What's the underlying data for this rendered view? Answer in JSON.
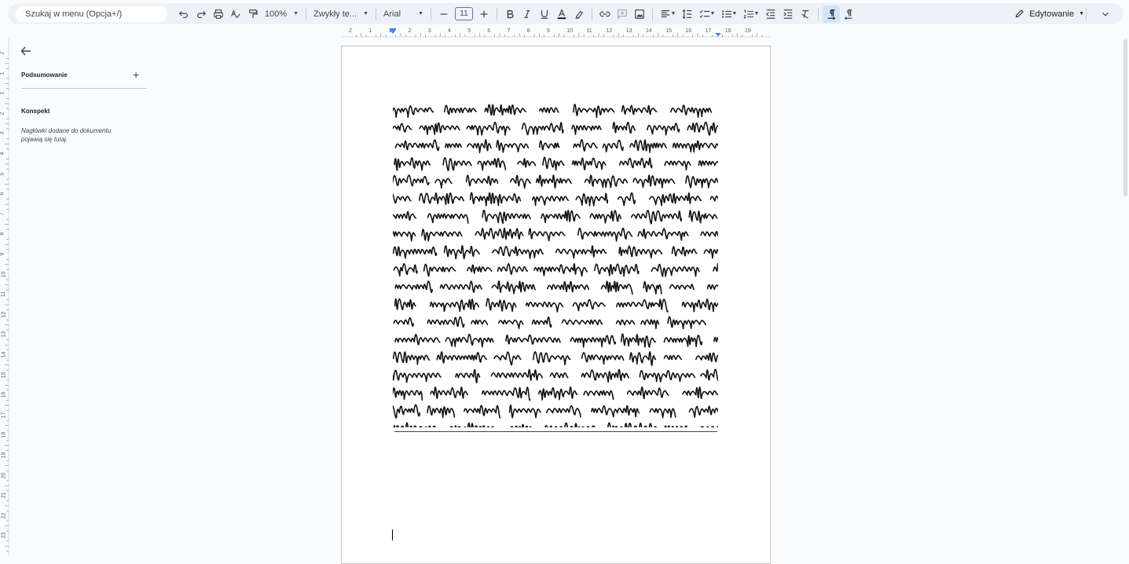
{
  "toolbar": {
    "search_placeholder": "Szukaj w menu (Opcja+/)",
    "zoom": "100%",
    "style": "Zwykły te...",
    "font": "Arial",
    "font_size": "11",
    "mode": "Edytowanie"
  },
  "ruler": {
    "horizontal": [
      "2",
      "1",
      "1",
      "2",
      "3",
      "4",
      "5",
      "6",
      "7",
      "8",
      "9",
      "10",
      "11",
      "12",
      "13",
      "14",
      "15",
      "16",
      "17",
      "18",
      "19"
    ],
    "vertical": [
      "2",
      "1",
      "1",
      "2",
      "3",
      "4",
      "5",
      "6",
      "7",
      "8",
      "9",
      "10",
      "11",
      "12",
      "13",
      "14",
      "15",
      "16",
      "17",
      "18",
      "19",
      "20",
      "21",
      "22",
      "23"
    ]
  },
  "sidebar": {
    "summary_title": "Podsumowanie",
    "outline_title": "Konspekt",
    "outline_hint": "Nagłówki dodane do dokumentu pojawią się tutaj."
  },
  "colors": {
    "toolbar_bg": "#edf2fa",
    "active_button": "#d3e3fd",
    "page_bg": "#ffffff",
    "canvas_bg": "#f9fbfd"
  }
}
